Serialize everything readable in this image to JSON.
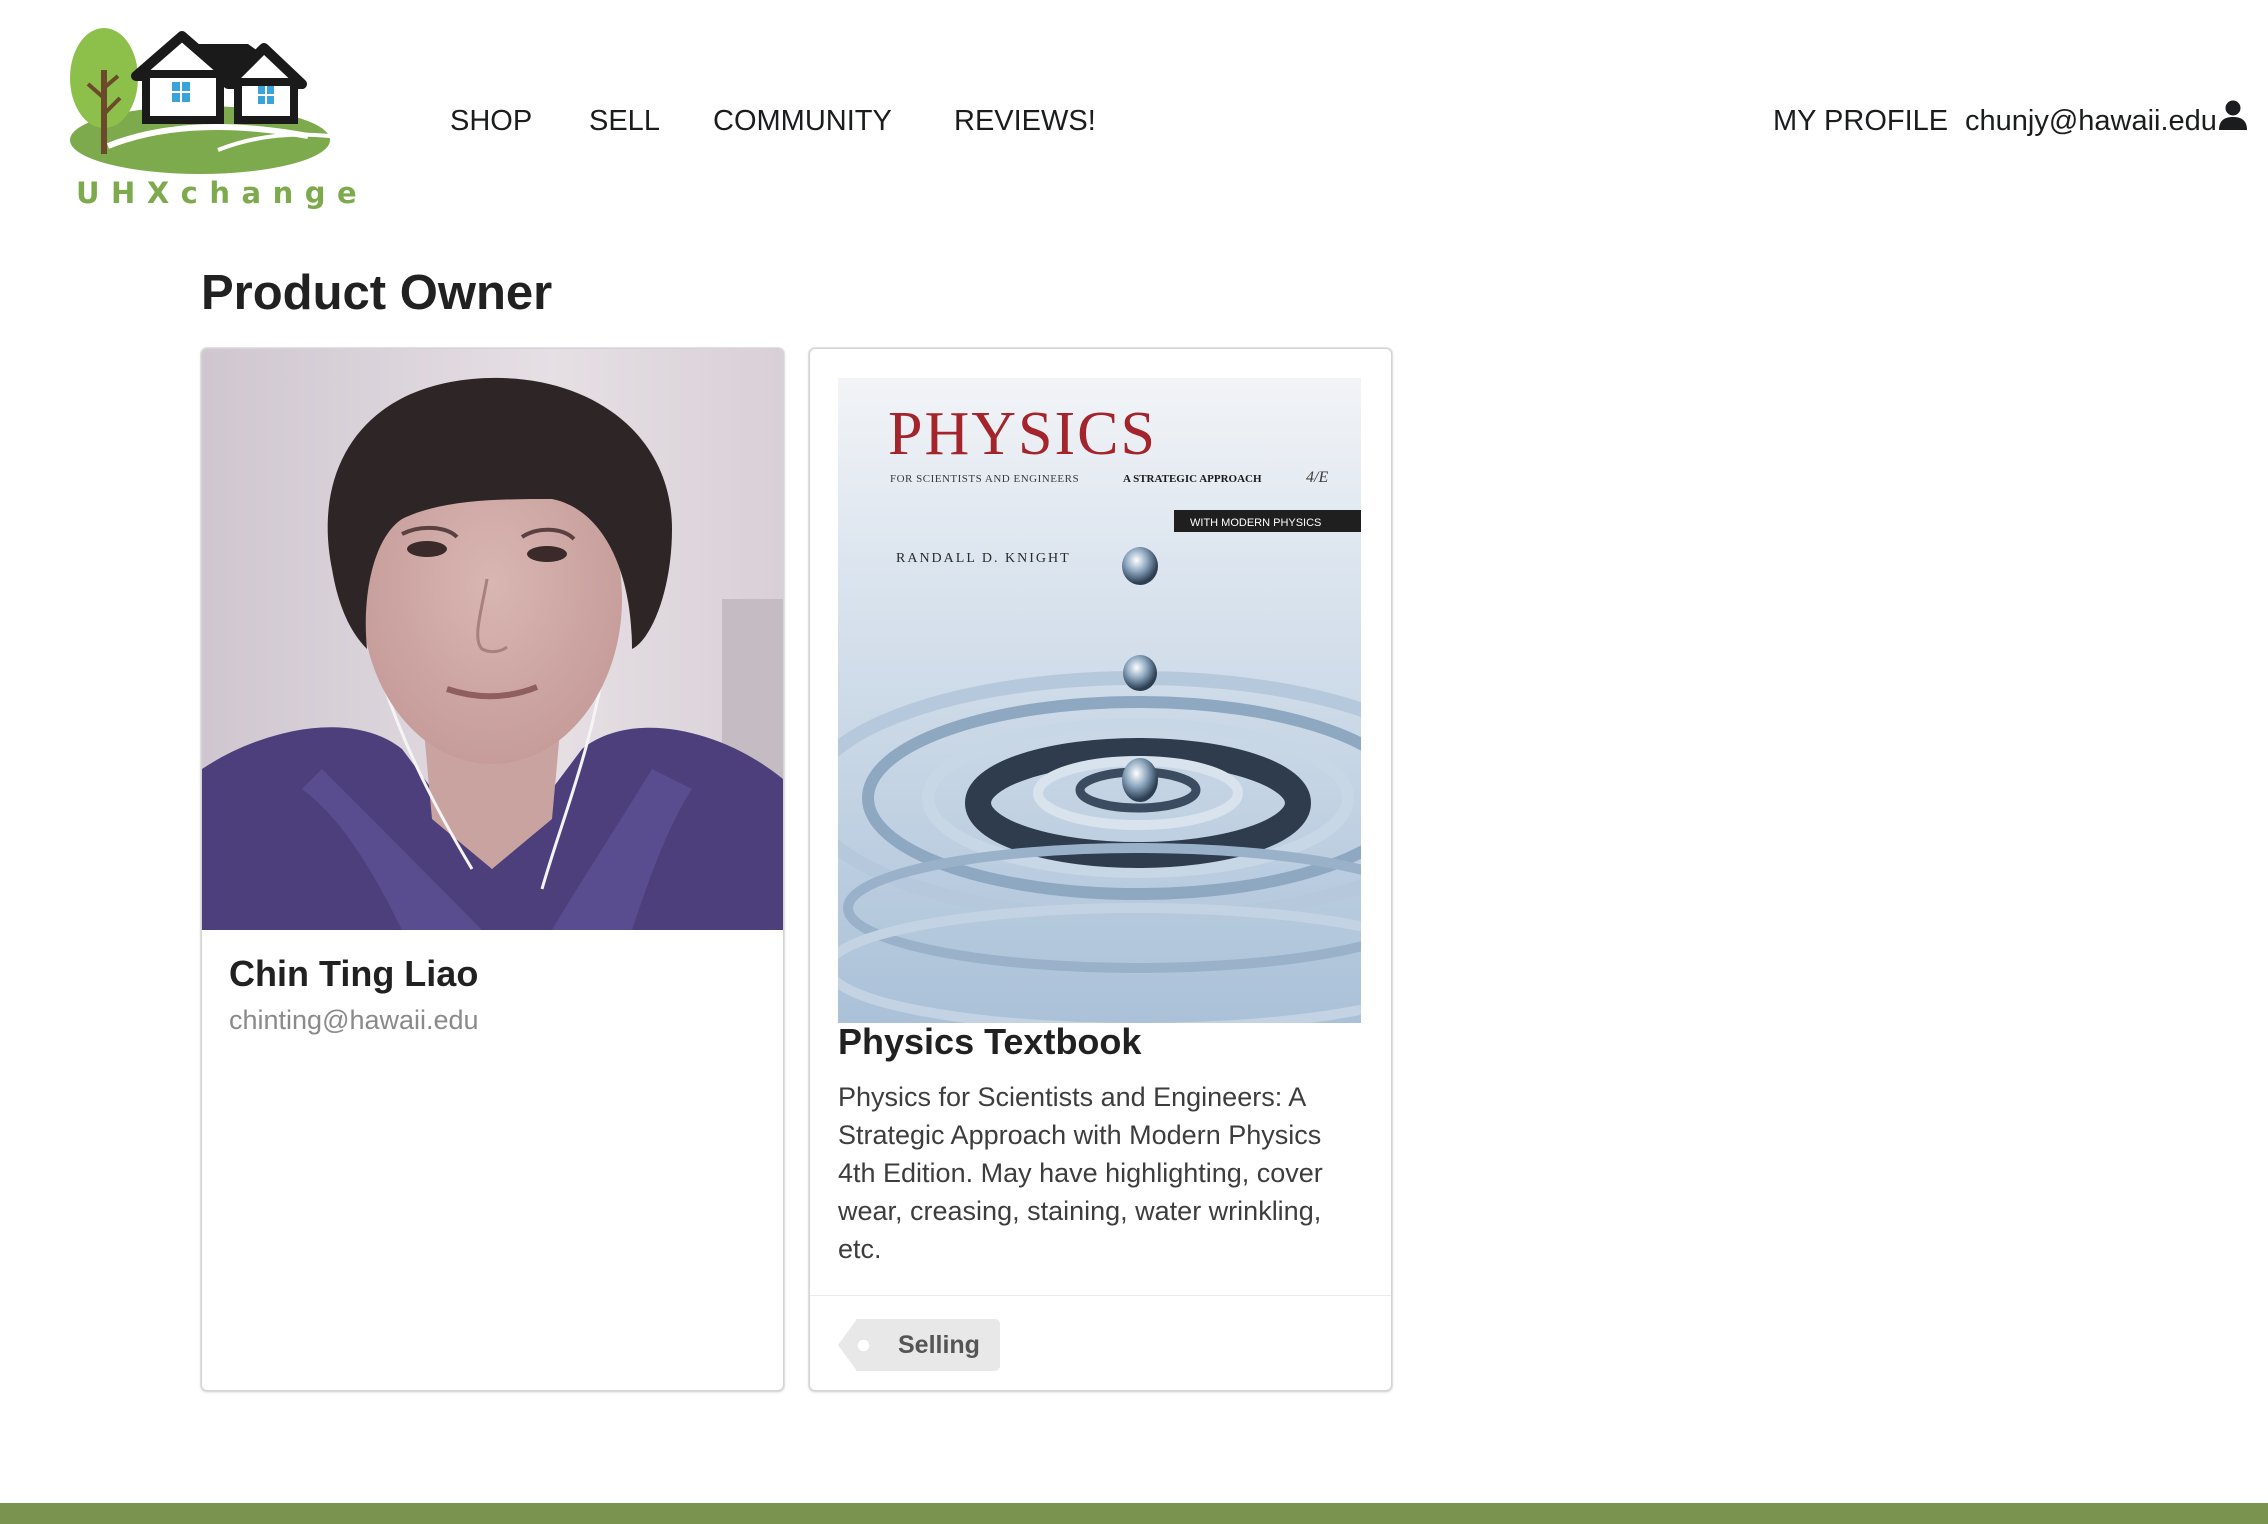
{
  "brand": {
    "logo_text": "UHXchange"
  },
  "nav": {
    "shop_label": "SHOP",
    "sell_label": "SELL",
    "community_label": "COMMUNITY",
    "reviews_label": "REVIEWS!",
    "profile_label": "MY PROFILE",
    "user_email": "chunjy@hawaii.edu",
    "user_icon": "user-icon"
  },
  "page": {
    "heading": "Product Owner"
  },
  "owner": {
    "name": "Chin Ting Liao",
    "email": "chinting@hawaii.edu"
  },
  "product": {
    "cover": {
      "title": "PHYSICS",
      "subtitle": "FOR SCIENTISTS AND ENGINEERS",
      "subtitle_bold": "A STRATEGIC APPROACH",
      "edition": "4/E",
      "badge": "WITH MODERN PHYSICS",
      "author": "RANDALL D. KNIGHT"
    },
    "title": "Physics Textbook",
    "description": "Physics for Scientists and Engineers: A Strategic Approach with Modern Physics 4th Edition. May have highlighting, cover wear, creasing, staining, water wrinkling, etc.",
    "status_tag": "Selling"
  },
  "colors": {
    "brand_green": "#7daa4c",
    "footer_green": "#7a944f",
    "tag_bg": "#e8e8e8",
    "book_title_red": "#a3242b"
  }
}
